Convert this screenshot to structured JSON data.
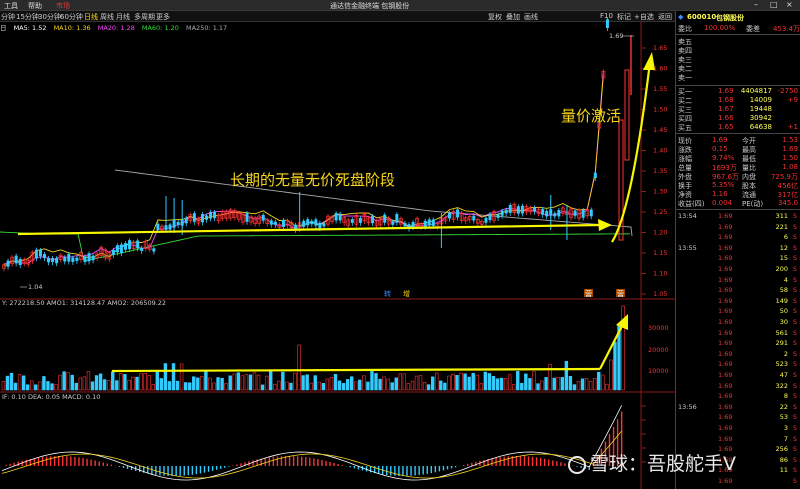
{
  "menu": {
    "items": [
      "工具",
      "帮助",
      "市场"
    ],
    "window_title": "通达信金融终端 包钢股份"
  },
  "toolbar": {
    "periods": [
      "分钟",
      "15分钟",
      "30分钟",
      "60分钟",
      "日线",
      "周线",
      "月线",
      "多周期",
      "更多"
    ],
    "active_period": "日线",
    "right_buttons": [
      "复权",
      "叠加",
      "画线",
      "F10",
      "标记",
      "+自选",
      "返回"
    ]
  },
  "ma_line": {
    "prefix": "日",
    "items": [
      {
        "text": "MA5: 1.52",
        "color": "#ffffff"
      },
      {
        "text": "MA10: 1.36",
        "color": "#f7d51d"
      },
      {
        "text": "MA20: 1.28",
        "color": "#ff44ff"
      },
      {
        "text": "MA60: 1.20",
        "color": "#33dd33"
      },
      {
        "text": "MA250: 1.17",
        "color": "#aaaaaa"
      }
    ]
  },
  "annotations": {
    "long_period": "长期的无量无价死盘阶段",
    "volume_price": "量价激活",
    "high_label": "1.69",
    "low_label": "1.04",
    "event_1": "转",
    "event_2": "增",
    "event_3": "营",
    "event_4": "营"
  },
  "price_axis": [
    "1.65",
    "1.60",
    "1.55",
    "1.50",
    "1.45",
    "1.40",
    "1.35",
    "1.30",
    "1.25",
    "1.20",
    "1.15",
    "1.10",
    "1.05"
  ],
  "volume": {
    "header": "Y: 272218.50  AMO1: 314128.47  AMO2: 206509.22",
    "axis": [
      "30000",
      "20000",
      "10000"
    ]
  },
  "macd": {
    "header": "IF: 0.10  DEA: 0.05  MACD: 0.10"
  },
  "right_panel": {
    "stock_code": "600010",
    "stock_name": "包钢股份",
    "commission_label": "委比",
    "commission_ratio": "100.00%",
    "commission_diff_label": "委差",
    "commission_diff": "453.4万",
    "sell": [
      {
        "label": "卖五",
        "price": "",
        "vol": ""
      },
      {
        "label": "卖四",
        "price": "",
        "vol": ""
      },
      {
        "label": "卖三",
        "price": "",
        "vol": ""
      },
      {
        "label": "卖二",
        "price": "",
        "vol": ""
      },
      {
        "label": "卖一",
        "price": "",
        "vol": ""
      }
    ],
    "buy": [
      {
        "label": "买一",
        "price": "1.69",
        "vol": "4404817",
        "chg": "-2750"
      },
      {
        "label": "买二",
        "price": "1.68",
        "vol": "14009",
        "chg": "+9"
      },
      {
        "label": "买三",
        "price": "1.67",
        "vol": "19448",
        "chg": ""
      },
      {
        "label": "买四",
        "price": "1.66",
        "vol": "30942",
        "chg": ""
      },
      {
        "label": "买五",
        "price": "1.65",
        "vol": "64638",
        "chg": "+1"
      }
    ],
    "quote": [
      {
        "l1": "现价",
        "v1": "1.69",
        "l2": "今开",
        "v2": "1.53"
      },
      {
        "l1": "涨跌",
        "v1": "0.15",
        "l2": "最高",
        "v2": "1.69"
      },
      {
        "l1": "涨幅",
        "v1": "9.74%",
        "l2": "最低",
        "v2": "1.50"
      },
      {
        "l1": "总量",
        "v1": "1693万",
        "l2": "量比",
        "v2": "1.08"
      },
      {
        "l1": "外盘",
        "v1": "967.6万",
        "l2": "内盘",
        "v2": "725.9万"
      },
      {
        "l1": "换手",
        "v1": "5.35%",
        "l2": "股本",
        "v2": "456亿"
      },
      {
        "l1": "净资",
        "v1": "1.16",
        "l2": "流通",
        "v2": "317亿"
      },
      {
        "l1": "收益(四)",
        "v1": "0.004",
        "l2": "PE(动)",
        "v2": "345.0"
      }
    ],
    "ticks": [
      {
        "t": "13:54",
        "p": "1.69",
        "v": "311",
        "f": "S"
      },
      {
        "t": "",
        "p": "1.69",
        "v": "221",
        "f": "S"
      },
      {
        "t": "",
        "p": "1.69",
        "v": "6",
        "f": "S"
      },
      {
        "t": "13:55",
        "p": "1.69",
        "v": "12",
        "f": "S"
      },
      {
        "t": "",
        "p": "1.69",
        "v": "15",
        "f": "S"
      },
      {
        "t": "",
        "p": "1.69",
        "v": "200",
        "f": "S"
      },
      {
        "t": "",
        "p": "1.69",
        "v": "4",
        "f": "S"
      },
      {
        "t": "",
        "p": "1.69",
        "v": "58",
        "f": "S"
      },
      {
        "t": "",
        "p": "1.69",
        "v": "149",
        "f": "S"
      },
      {
        "t": "",
        "p": "1.69",
        "v": "50",
        "f": "S"
      },
      {
        "t": "",
        "p": "1.69",
        "v": "30",
        "f": "S"
      },
      {
        "t": "",
        "p": "1.69",
        "v": "561",
        "f": "S"
      },
      {
        "t": "",
        "p": "1.69",
        "v": "291",
        "f": "S"
      },
      {
        "t": "",
        "p": "1.69",
        "v": "2",
        "f": "S"
      },
      {
        "t": "",
        "p": "1.69",
        "v": "523",
        "f": "S"
      },
      {
        "t": "",
        "p": "1.69",
        "v": "47",
        "f": "S"
      },
      {
        "t": "",
        "p": "1.69",
        "v": "322",
        "f": "S"
      },
      {
        "t": "",
        "p": "1.69",
        "v": "8",
        "f": "S"
      },
      {
        "t": "13:56",
        "p": "1.69",
        "v": "22",
        "f": "S"
      },
      {
        "t": "",
        "p": "1.69",
        "v": "53",
        "f": "S"
      },
      {
        "t": "",
        "p": "1.69",
        "v": "3",
        "f": "S"
      },
      {
        "t": "",
        "p": "1.69",
        "v": "7",
        "f": "S"
      },
      {
        "t": "",
        "p": "1.69",
        "v": "256",
        "f": "S"
      },
      {
        "t": "",
        "p": "1.69",
        "v": "86",
        "f": "S"
      },
      {
        "t": "",
        "p": "1.69",
        "v": "11",
        "f": "S"
      },
      {
        "t": "",
        "p": "1.69",
        "v": "",
        "f": "S"
      }
    ]
  },
  "watermark": {
    "text": "雪球：吾股舵手V"
  }
}
